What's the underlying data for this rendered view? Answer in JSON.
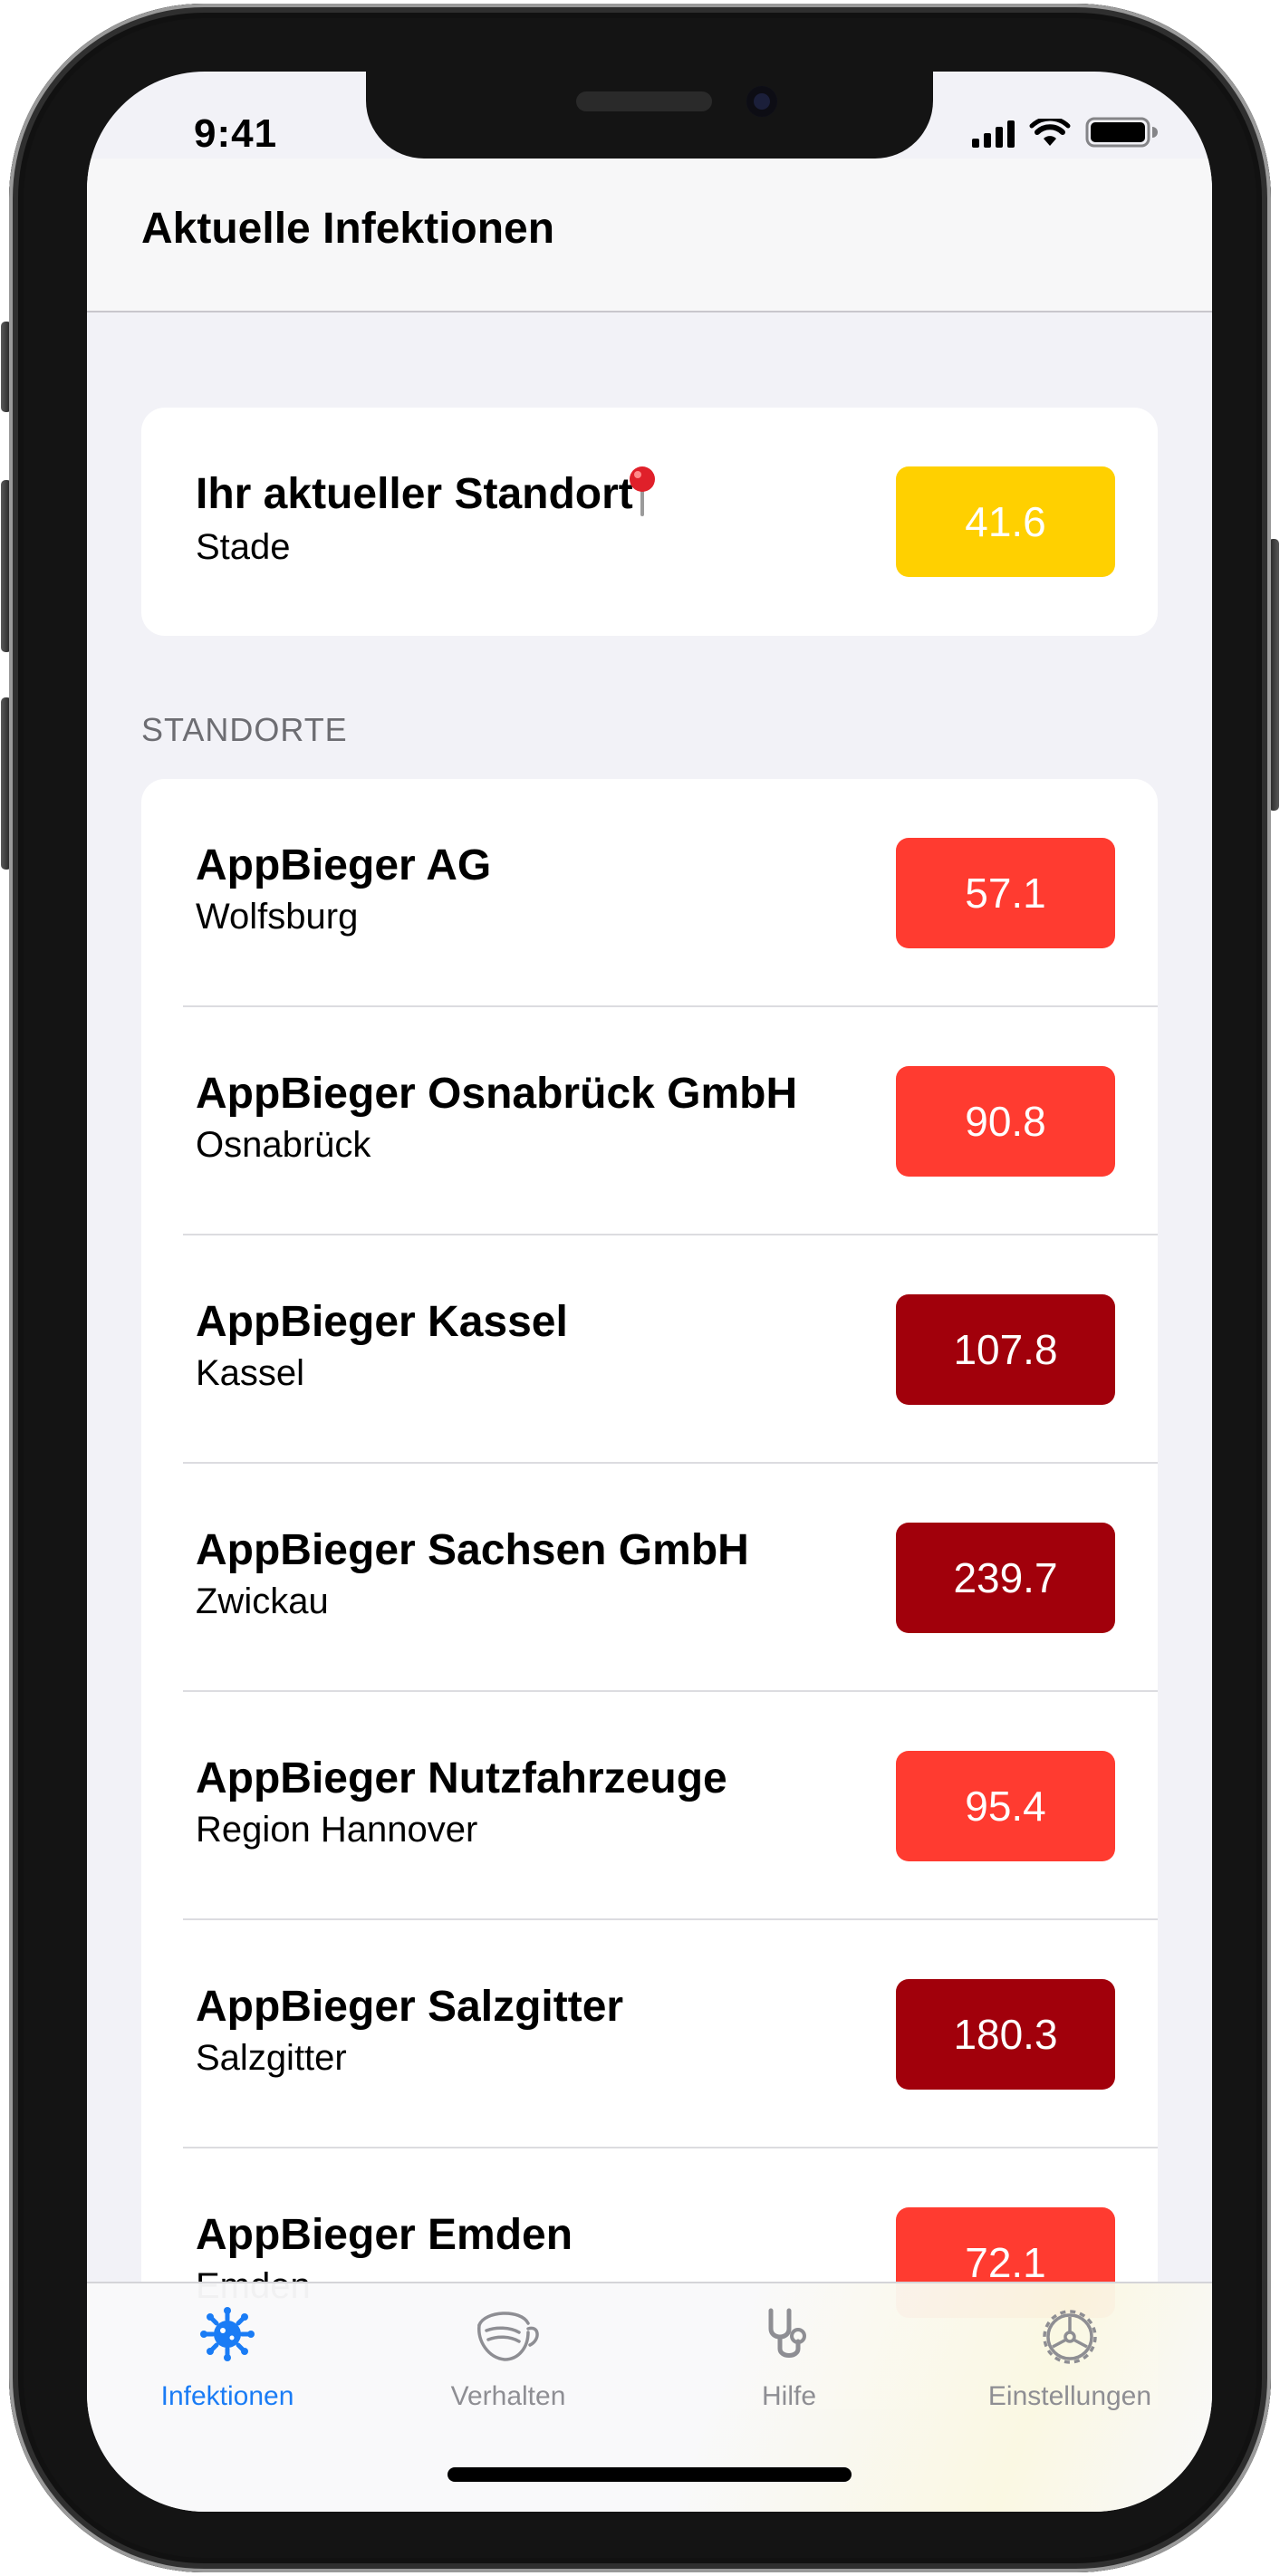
{
  "status": {
    "time": "9:41"
  },
  "nav": {
    "title": "Aktuelle Infektionen"
  },
  "location_card": {
    "title": "Ihr aktueller Standort",
    "pin_icon": "map-pin-icon",
    "city": "Stade",
    "value": "41.6",
    "color": "#FFD000"
  },
  "section": {
    "header": "STANDORTE"
  },
  "locations": [
    {
      "name": "AppBieger AG",
      "city": "Wolfsburg",
      "value": "57.1",
      "color": "#FF3B30"
    },
    {
      "name": "AppBieger Osnabrück GmbH",
      "city": "Osnabrück",
      "value": "90.8",
      "color": "#FF3B30"
    },
    {
      "name": "AppBieger Kassel",
      "city": "Kassel",
      "value": "107.8",
      "color": "#A1000B"
    },
    {
      "name": "AppBieger Sachsen GmbH",
      "city": "Zwickau",
      "value": "239.7",
      "color": "#A1000B"
    },
    {
      "name": "AppBieger Nutzfahrzeuge",
      "city": "Region Hannover",
      "value": "95.4",
      "color": "#FF3B30"
    },
    {
      "name": "AppBieger Salzgitter",
      "city": "Salzgitter",
      "value": "180.3",
      "color": "#A1000B"
    },
    {
      "name": "AppBieger Emden",
      "city": "Emden",
      "value": "72.1",
      "color": "#FF3B30"
    }
  ],
  "tabs": [
    {
      "label": "Infektionen",
      "icon": "virus-icon",
      "active": true
    },
    {
      "label": "Verhalten",
      "icon": "face-mask-icon",
      "active": false
    },
    {
      "label": "Hilfe",
      "icon": "stethoscope-icon",
      "active": false
    },
    {
      "label": "Einstellungen",
      "icon": "gear-icon",
      "active": false
    }
  ],
  "colors": {
    "accent": "#1A7CF5",
    "inactive": "#8E8E93"
  }
}
